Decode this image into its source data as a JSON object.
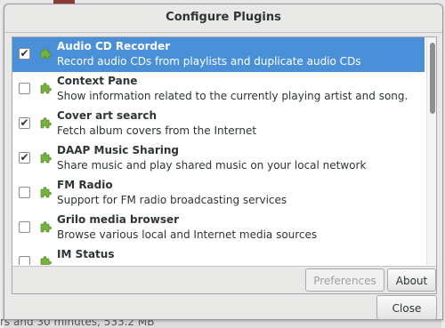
{
  "dialog": {
    "title": "Configure Plugins",
    "close_label": "Close"
  },
  "background": {
    "status_text": "rs and 30 minutes, 533.2 MB"
  },
  "plugins": [
    {
      "name": "Audio CD Recorder",
      "description": "Record audio CDs from playlists and duplicate audio CDs",
      "enabled": true,
      "selected": true
    },
    {
      "name": "Context Pane",
      "description": "Show information related to the currently playing artist and song.",
      "enabled": false,
      "selected": false
    },
    {
      "name": "Cover art search",
      "description": "Fetch album covers from the Internet",
      "enabled": true,
      "selected": false
    },
    {
      "name": "DAAP Music Sharing",
      "description": "Share music and play shared music on your local network",
      "enabled": true,
      "selected": false
    },
    {
      "name": "FM Radio",
      "description": "Support for FM radio broadcasting services",
      "enabled": false,
      "selected": false
    },
    {
      "name": "Grilo media browser",
      "description": "Browse various local and Internet media sources",
      "enabled": false,
      "selected": false
    },
    {
      "name": "IM Status",
      "description": "",
      "enabled": false,
      "selected": false
    }
  ],
  "toolbar": {
    "preferences_label": "Preferences",
    "about_label": "About"
  },
  "icons": {
    "plugin": "puzzle-piece-icon",
    "check": "✔"
  },
  "colors": {
    "selection": "#4a90d9",
    "plugin_icon": "#73b23c"
  }
}
